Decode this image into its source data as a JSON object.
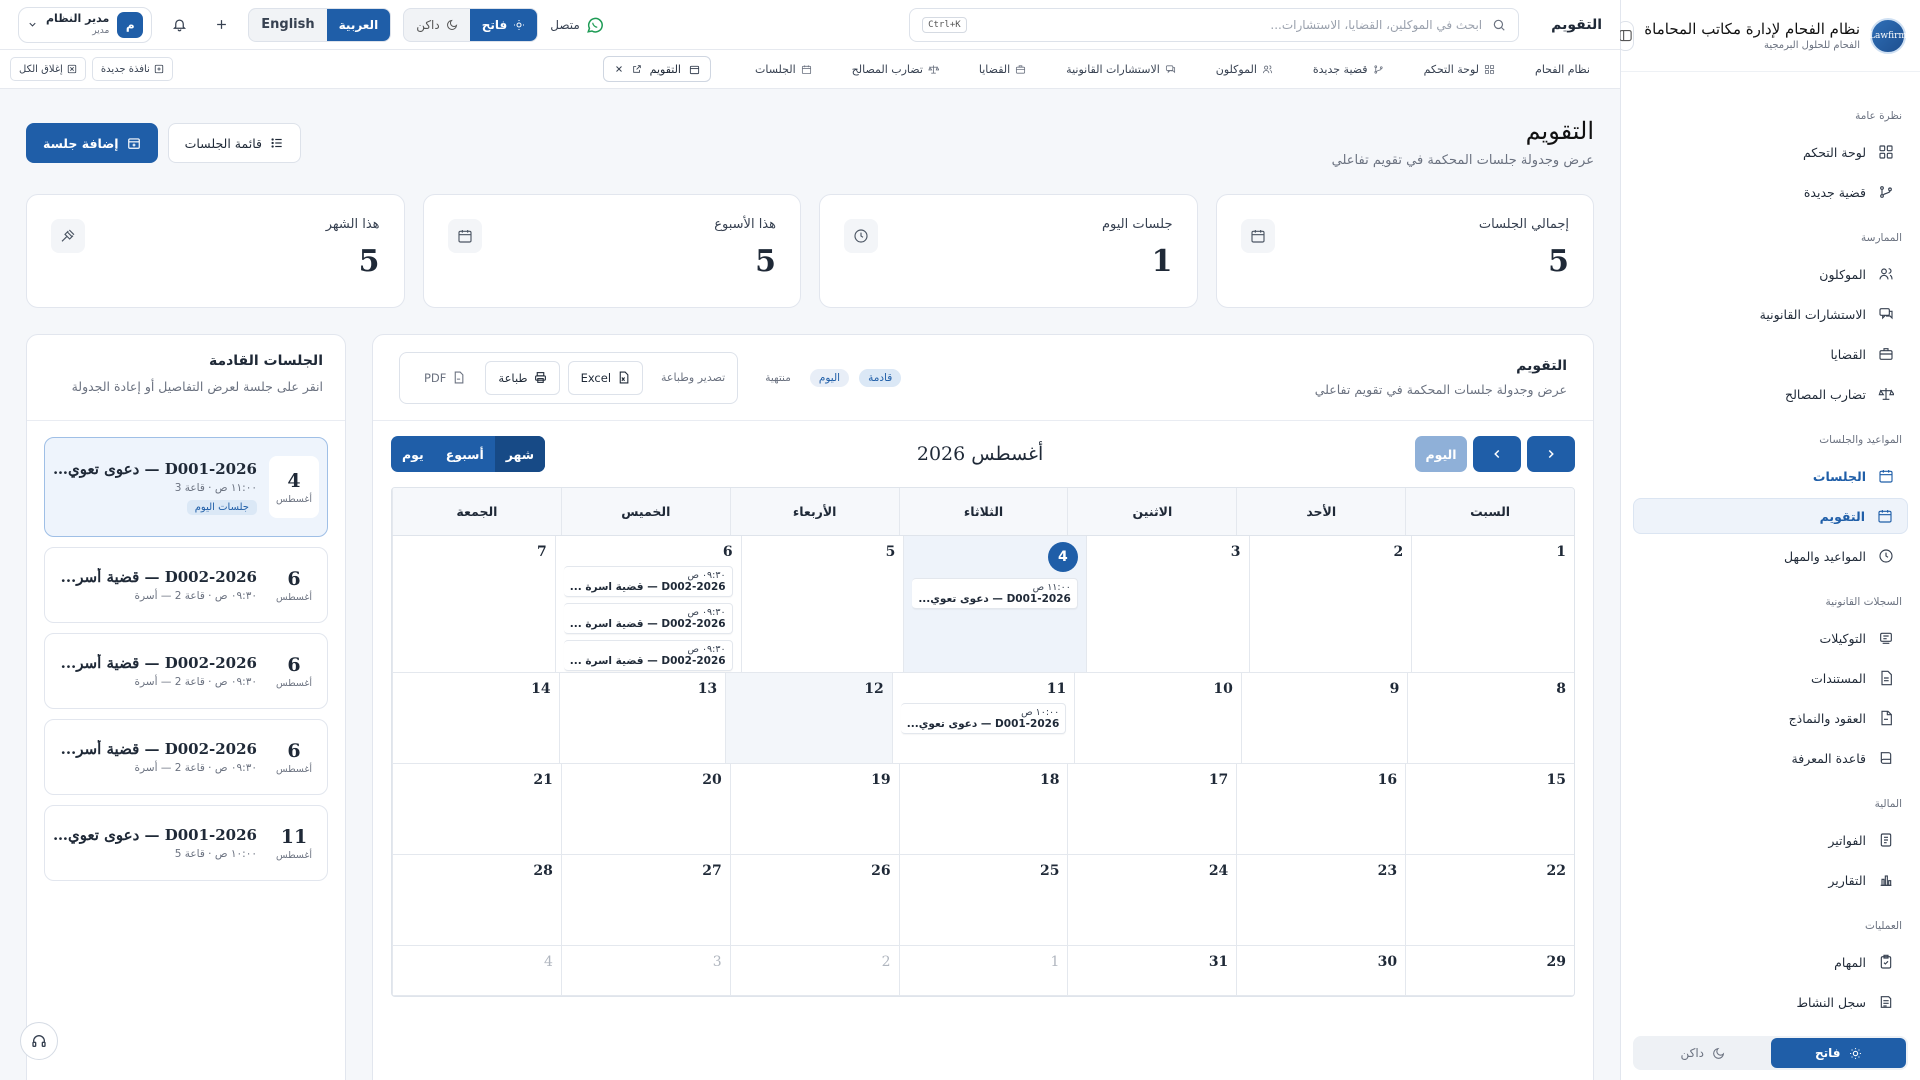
{
  "sidebar": {
    "brand_title": "نظام الفحام لإدارة مكاتب المحاماة",
    "brand_subtitle": "الفحام للحلول البرمجية",
    "logo_text": "Lawfirm",
    "sections": [
      {
        "title": "نظرة عامة",
        "items": [
          {
            "label": "لوحة التحكم",
            "icon": "dashboard-icon"
          },
          {
            "label": "قضية جديدة",
            "icon": "new-case-icon"
          }
        ]
      },
      {
        "title": "الممارسة",
        "items": [
          {
            "label": "الموكلون",
            "icon": "users-icon"
          },
          {
            "label": "الاستشارات القانونية",
            "icon": "consult-icon"
          },
          {
            "label": "القضايا",
            "icon": "briefcase-icon"
          },
          {
            "label": "تضارب المصالح",
            "icon": "scale-icon"
          }
        ]
      },
      {
        "title": "المواعيد والجلسات",
        "items": [
          {
            "label": "الجلسات",
            "icon": "calendar-icon"
          },
          {
            "label": "التقويم",
            "icon": "calendar-icon"
          },
          {
            "label": "المواعيد والمهل",
            "icon": "clock-icon"
          }
        ]
      },
      {
        "title": "السجلات القانونية",
        "items": [
          {
            "label": "التوكيلات",
            "icon": "stamp-icon"
          },
          {
            "label": "المستندات",
            "icon": "document-icon"
          },
          {
            "label": "العقود والنماذج",
            "icon": "contract-icon"
          },
          {
            "label": "قاعدة المعرفة",
            "icon": "book-icon"
          }
        ]
      },
      {
        "title": "المالية",
        "items": [
          {
            "label": "الفواتير",
            "icon": "invoice-icon"
          },
          {
            "label": "التقارير",
            "icon": "chart-icon"
          }
        ]
      },
      {
        "title": "العمليات",
        "items": [
          {
            "label": "المهام",
            "icon": "tasks-icon"
          },
          {
            "label": "سجل النشاط",
            "icon": "activity-icon"
          }
        ]
      }
    ],
    "theme_light": "فاتح",
    "theme_dark": "داكن"
  },
  "topbar": {
    "title": "التقويم",
    "search_placeholder": "ابحث في الموكلين، القضايا، الاستشارات...",
    "search_shortcut": "Ctrl+K",
    "status": "متصل",
    "theme_light": "فاتح",
    "theme_dark": "داكن",
    "lang_ar": "العربية",
    "lang_en": "English",
    "user_name": "مدير النظام",
    "user_role": "مدير",
    "user_initial": "م"
  },
  "quickbar": {
    "links": [
      "نظام الفحام",
      "لوحة التحكم",
      "قضية جديدة",
      "الموكلون",
      "الاستشارات القانونية",
      "القضايا",
      "تضارب المصالح",
      "الجلسات"
    ],
    "open_tab": "التقويم",
    "new_window": "نافذة جديدة",
    "close_all": "إغلاق الكل"
  },
  "page": {
    "title": "التقويم",
    "subtitle": "عرض وجدولة جلسات المحكمة في تقويم تفاعلي",
    "list_button": "قائمة الجلسات",
    "add_button": "إضافة جلسة"
  },
  "stats": [
    {
      "label": "إجمالي الجلسات",
      "value": "5",
      "icon": "calendar-icon"
    },
    {
      "label": "جلسات اليوم",
      "value": "1",
      "icon": "clock-icon"
    },
    {
      "label": "هذا الأسبوع",
      "value": "5",
      "icon": "calendar-icon"
    },
    {
      "label": "هذا الشهر",
      "value": "5",
      "icon": "gavel-icon"
    }
  ],
  "calendar": {
    "title": "التقويم",
    "subtitle": "عرض وجدولة جلسات المحكمة في تقويم تفاعلي",
    "legend": {
      "upcoming": "قادمة",
      "today": "اليوم",
      "done": "منتهية"
    },
    "export_label": "تصدير وطباعة",
    "excel": "Excel",
    "print": "طباعة",
    "pdf": "PDF",
    "today_button": "اليوم",
    "month_title": "أغسطس 2026",
    "views": {
      "month": "شهر",
      "week": "أسبوع",
      "day": "يوم"
    },
    "weekdays": [
      "السبت",
      "الأحد",
      "الاثنين",
      "الثلاثاء",
      "الأربعاء",
      "الخميس",
      "الجمعة"
    ],
    "weeks": [
      [
        {
          "d": "1"
        },
        {
          "d": "2"
        },
        {
          "d": "3"
        },
        {
          "d": "4",
          "today": true,
          "events": [
            {
              "time": "١١:٠٠ ص",
              "text": "D001-2026 — دعوى تعوي..."
            }
          ]
        },
        {
          "d": "5"
        },
        {
          "d": "6",
          "events": [
            {
              "time": "٠٩:٣٠ ص",
              "text": "D002-2026 — قضية اسرة ..."
            },
            {
              "time": "٠٩:٣٠ ص",
              "text": "D002-2026 — قضية اسرة ..."
            },
            {
              "time": "٠٩:٣٠ ص",
              "text": "D002-2026 — قضية اسرة ..."
            }
          ]
        },
        {
          "d": "7"
        }
      ],
      [
        {
          "d": "8"
        },
        {
          "d": "9"
        },
        {
          "d": "10"
        },
        {
          "d": "11",
          "events": [
            {
              "time": "١٠:٠٠ ص",
              "text": "D001-2026 — دعوى تعوي..."
            }
          ]
        },
        {
          "d": "12",
          "shaded": true
        },
        {
          "d": "13"
        },
        {
          "d": "14"
        }
      ],
      [
        {
          "d": "15"
        },
        {
          "d": "16"
        },
        {
          "d": "17"
        },
        {
          "d": "18"
        },
        {
          "d": "19"
        },
        {
          "d": "20"
        },
        {
          "d": "21"
        }
      ],
      [
        {
          "d": "22"
        },
        {
          "d": "23"
        },
        {
          "d": "24"
        },
        {
          "d": "25"
        },
        {
          "d": "26"
        },
        {
          "d": "27"
        },
        {
          "d": "28"
        }
      ],
      [
        {
          "d": "29"
        },
        {
          "d": "30"
        },
        {
          "d": "31"
        },
        {
          "d": "1",
          "dim": true
        },
        {
          "d": "2",
          "dim": true
        },
        {
          "d": "3",
          "dim": true
        },
        {
          "d": "4",
          "dim": true
        }
      ]
    ]
  },
  "upcoming": {
    "title": "الجلسات القادمة",
    "subtitle": "انقر على جلسة لعرض التفاصيل أو إعادة الجدولة",
    "items": [
      {
        "day": "4",
        "month": "أغسطس",
        "title": "D001-2026 — دعوى تعوي...",
        "meta": "١١:٠٠ ص · قاعة 3",
        "tag": "جلسات اليوم",
        "selected": true
      },
      {
        "day": "6",
        "month": "أغسطس",
        "title": "D002-2026 — قضية أسر...",
        "meta": "٠٩:٣٠ ص · قاعة 2 — أسرة"
      },
      {
        "day": "6",
        "month": "أغسطس",
        "title": "D002-2026 — قضية أسر...",
        "meta": "٠٩:٣٠ ص · قاعة 2 — أسرة"
      },
      {
        "day": "6",
        "month": "أغسطس",
        "title": "D002-2026 — قضية أسر...",
        "meta": "٠٩:٣٠ ص · قاعة 2 — أسرة"
      },
      {
        "day": "11",
        "month": "أغسطس",
        "title": "D001-2026 — دعوى تعوي...",
        "meta": "١٠:٠٠ ص · قاعة 5"
      }
    ]
  },
  "colors": {
    "primary": "#1f5ea8",
    "primary_light": "#dbe8f6",
    "today_bg": "#eef3fa"
  }
}
